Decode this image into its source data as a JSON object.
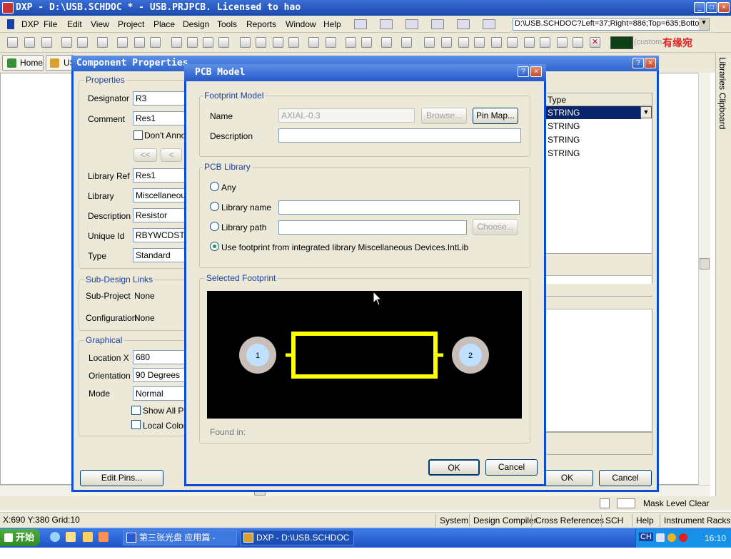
{
  "app": {
    "title": "DXP - D:\\USB.SCHDOC * - USB.PRJPCB. Licensed to hao",
    "menus": [
      "DXP",
      "File",
      "Edit",
      "View",
      "Project",
      "Place",
      "Design",
      "Tools",
      "Reports",
      "Window",
      "Help"
    ],
    "doc_path": "D:\\USB.SCHDOC?Left=37;Right=886;Top=635;Bottor",
    "color_label": "(custom",
    "logo_text": "有缘宛"
  },
  "tabs": {
    "home": "Home",
    "second": "US"
  },
  "right_panel": {
    "libraries": "Libraries",
    "clipboard": "Clipboard"
  },
  "status": {
    "coords": "X:690 Y:380   Grid:10",
    "mask_level": "Mask Level",
    "clear": "Clear",
    "buttons": [
      "System",
      "Design Compiler",
      "Cross References",
      "SCH",
      "Help",
      "Instrument Racks"
    ]
  },
  "taskbar": {
    "start": "开始",
    "task1": "第三张光盘 应用篇 - Mic...",
    "task2": "DXP - D:\\USB.SCHDOC * ...",
    "lang": "CH",
    "time": "16:10"
  },
  "component_properties": {
    "title": "Component Properties",
    "properties_group": "Properties",
    "designator_label": "Designator",
    "designator_value": "R3",
    "comment_label": "Comment",
    "comment_value": "Res1",
    "dont_annotate": "Don't Annot",
    "nav_first": "<<",
    "nav_prev": "<",
    "library_ref_label": "Library Ref",
    "library_ref_value": "Res1",
    "library_label": "Library",
    "library_value": "Miscellaneous",
    "description_label": "Description",
    "description_value": "Resistor",
    "unique_id_label": "Unique Id",
    "unique_id_value": "RBYWCDST",
    "type_label": "Type",
    "type_value": "Standard",
    "subdesign_group": "Sub-Design Links",
    "subproject_label": "Sub-Project",
    "subproject_value": "None",
    "configuration_label": "Configuration",
    "configuration_value": "None",
    "graphical_group": "Graphical",
    "location_label": "Location  X",
    "location_value": "680",
    "orientation_label": "Orientation",
    "orientation_value": "90 Degrees",
    "mode_label": "Mode",
    "mode_value": "Normal",
    "show_all_pins": "Show All Pir",
    "local_colors": "Local Colors",
    "edit_pins": "Edit Pins...",
    "ok": "OK",
    "cancel": "Cancel",
    "param_type_header": "Type",
    "param_types": [
      "STRING",
      "STRING",
      "STRING",
      "STRING"
    ]
  },
  "pcb_model": {
    "title": "PCB Model",
    "footprint_group": "Footprint Model",
    "name_label": "Name",
    "name_value": "AXIAL-0.3",
    "browse": "Browse...",
    "pin_map": "Pin Map...",
    "description_label": "Description",
    "description_value": "",
    "library_group": "PCB Library",
    "any": "Any",
    "library_name": "Library name",
    "library_path": "Library path",
    "choose": "Choose...",
    "use_integrated": "Use footprint from integrated library Miscellaneous Devices.IntLib",
    "selected_group": "Selected Footprint",
    "pad1": "1",
    "pad2": "2",
    "found_in": "Found in:",
    "ok": "OK",
    "cancel": "Cancel",
    "colors": {
      "canvas": "#000000",
      "body": "#ffff00",
      "pad_ring": "#c8bfb8",
      "pad_hole": "#bfe0ff"
    }
  }
}
